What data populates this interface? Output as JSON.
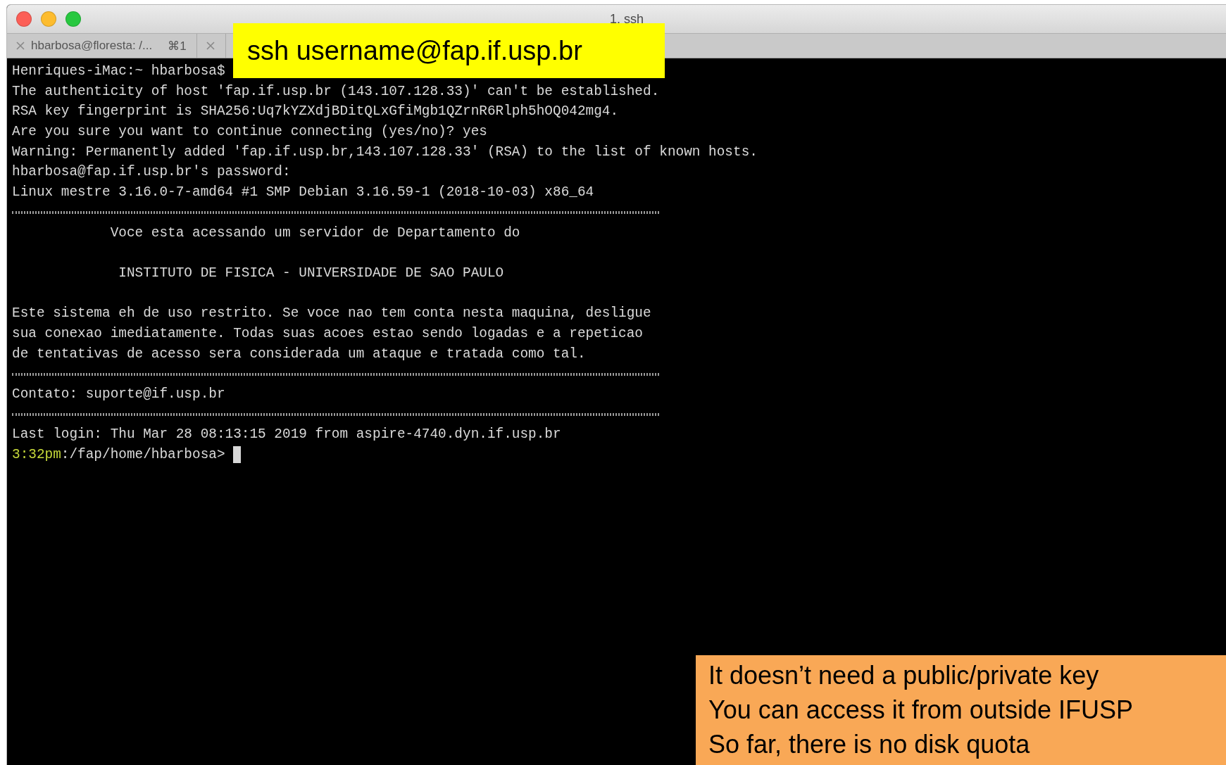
{
  "window": {
    "title": "1. ssh"
  },
  "tabs": [
    {
      "kind": "full",
      "title": "hbarbosa@floresta: /...",
      "shortcut": "⌘1"
    },
    {
      "kind": "partial"
    }
  ],
  "terminal": {
    "lines": [
      {
        "kind": "text",
        "text": "Henriques-iMac:~ hbarbosa$"
      },
      {
        "kind": "text",
        "text": "The authenticity of host 'fap.if.usp.br (143.107.128.33)' can't be established."
      },
      {
        "kind": "text",
        "text": "RSA key fingerprint is SHA256:Uq7kYZXdjBDitQLxGfiMgb1QZrnR6Rlph5hOQ042mg4."
      },
      {
        "kind": "text",
        "text": "Are you sure you want to continue connecting (yes/no)? yes"
      },
      {
        "kind": "text",
        "text": "Warning: Permanently added 'fap.if.usp.br,143.107.128.33' (RSA) to the list of known hosts."
      },
      {
        "kind": "text",
        "text": "hbarbosa@fap.if.usp.br's password:"
      },
      {
        "kind": "text",
        "text": "Linux mestre 3.16.0-7-amd64 #1 SMP Debian 3.16.59-1 (2018-10-03) x86_64"
      },
      {
        "kind": "rule"
      },
      {
        "kind": "text",
        "text": "            Voce esta acessando um servidor de Departamento do"
      },
      {
        "kind": "blank"
      },
      {
        "kind": "text",
        "text": "             INSTITUTO DE FISICA - UNIVERSIDADE DE SAO PAULO"
      },
      {
        "kind": "blank"
      },
      {
        "kind": "text",
        "text": "Este sistema eh de uso restrito. Se voce nao tem conta nesta maquina, desligue"
      },
      {
        "kind": "text",
        "text": "sua conexao imediatamente. Todas suas acoes estao sendo logadas e a repeticao"
      },
      {
        "kind": "text",
        "text": "de tentativas de acesso sera considerada um ataque e tratada como tal."
      },
      {
        "kind": "rule"
      },
      {
        "kind": "text",
        "text": "Contato: suporte@if.usp.br"
      },
      {
        "kind": "rule"
      },
      {
        "kind": "text",
        "text": "Last login: Thu Mar 28 08:13:15 2019 from aspire-4740.dyn.if.usp.br"
      },
      {
        "kind": "prompt",
        "time": "3:32pm",
        "path": ":/fap/home/hbarbosa>"
      }
    ]
  },
  "callouts": [
    {
      "kind": "command",
      "text": "ssh username@fap.if.usp.br"
    },
    {
      "kind": "note",
      "lines": [
        "It doesn’t need a public/private key",
        "You can access it from outside IFUSP",
        "So far, there is no disk quota"
      ]
    }
  ]
}
